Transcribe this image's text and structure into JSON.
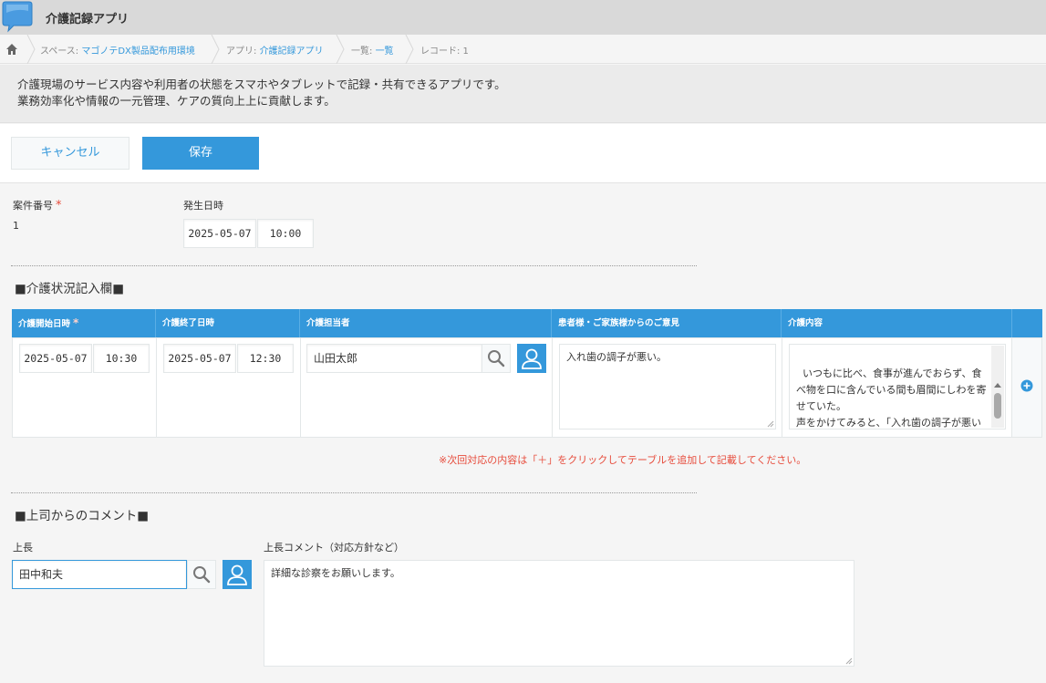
{
  "app": {
    "title": "介護記録アプリ"
  },
  "breadcrumb": {
    "space_prefix": "スペース: ",
    "space_name": "マゴノテDX製品配布用環境",
    "app_prefix": "アプリ: ",
    "app_name": "介護記録アプリ",
    "list_prefix": "一覧: ",
    "list_name": "一覧",
    "record": "レコード: 1"
  },
  "description": {
    "line1": "介護現場のサービス内容や利用者の状態をスマホやタブレットで記録・共有できるアプリです。",
    "line2": "業務効率化や情報の一元管理、ケアの質向上上に貢献します。"
  },
  "toolbar": {
    "cancel_label": "キャンセル",
    "save_label": "保存"
  },
  "fields": {
    "case_number": {
      "label": "案件番号",
      "required_mark": "*",
      "value": "1"
    },
    "occurrence": {
      "label": "発生日時",
      "date": "2025-05-07",
      "time": "10:00"
    }
  },
  "section_care": {
    "title": "■介護状況記入欄■"
  },
  "care_table": {
    "headers": {
      "start": "介護開始日時",
      "start_required": "*",
      "end": "介護終了日時",
      "staff": "介護担当者",
      "opinion": "患者様・ご家族様からのご意見",
      "content": "介護内容"
    },
    "row": {
      "start_date": "2025-05-07",
      "start_time": "10:30",
      "end_date": "2025-05-07",
      "end_time": "12:30",
      "staff": "山田太郎",
      "opinion": "入れ歯の調子が悪い。",
      "content": "いつもに比べ、食事が進んでおらず、食べ物を口に含んでいる間も眉間にしわを寄せていた。\n声をかけてみると、「入れ歯の調子が悪いようで、硬いものを食べると痛くて食べられない」とのこと。"
    }
  },
  "notice": "※次回対応の内容は「＋」をクリックしてテーブルを追加して記載してください。",
  "section_comment": {
    "title": "■上司からのコメント■"
  },
  "boss": {
    "label": "上長",
    "value": "田中和夫"
  },
  "boss_comment": {
    "label": "上長コメント（対応方針など）",
    "value": "詳細な診察をお願いします。"
  },
  "colors": {
    "accent": "#3498db",
    "required": "#e74c3c"
  }
}
